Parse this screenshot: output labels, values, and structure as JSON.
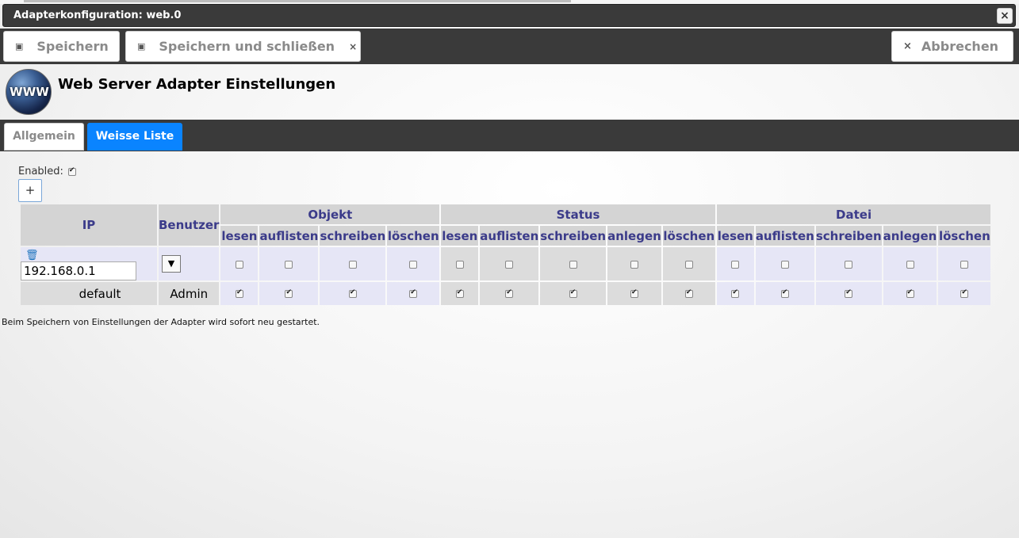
{
  "window": {
    "title": "Adapterkonfiguration: web.0",
    "close_glyph": "×"
  },
  "toolbar": {
    "save_label": "Speichern",
    "save_close_label": "Speichern und schließen",
    "cancel_label": "Abbrechen",
    "save_icon": "floppy-icon",
    "close_glyph": "×"
  },
  "header": {
    "logo_text": "WWW",
    "title": "Web Server Adapter Einstellungen"
  },
  "tabs": [
    {
      "label": "Allgemein",
      "active": false
    },
    {
      "label": "Weisse Liste",
      "active": true
    }
  ],
  "enabled": {
    "label": "Enabled:",
    "checked": true
  },
  "add_button": {
    "label": "+"
  },
  "table": {
    "col_ip": "IP",
    "col_user": "Benutzer",
    "groups": [
      {
        "label": "Objekt",
        "cols": [
          "lesen",
          "auflisten",
          "schreiben",
          "löschen"
        ]
      },
      {
        "label": "Status",
        "cols": [
          "lesen",
          "auflisten",
          "schreiben",
          "anlegen",
          "löschen"
        ]
      },
      {
        "label": "Datei",
        "cols": [
          "lesen",
          "auflisten",
          "schreiben",
          "anlegen",
          "löschen"
        ]
      }
    ],
    "rows": [
      {
        "ip": "192.168.0.1",
        "user": "",
        "editable": true,
        "perms": [
          false,
          false,
          false,
          false,
          false,
          false,
          false,
          false,
          false,
          false,
          false,
          false,
          false,
          false
        ]
      },
      {
        "ip": "default",
        "user": "Admin",
        "editable": false,
        "perms": [
          true,
          true,
          true,
          true,
          true,
          true,
          true,
          true,
          true,
          true,
          true,
          true,
          true,
          true
        ]
      }
    ]
  },
  "footer_note": "Beim Speichern von Einstellungen der Adapter wird sofort neu gestartet.",
  "colors": {
    "tab_active": "#0a84ff",
    "toolbar_bg": "#3a3a3a",
    "header_text": "#3b3b8a"
  }
}
